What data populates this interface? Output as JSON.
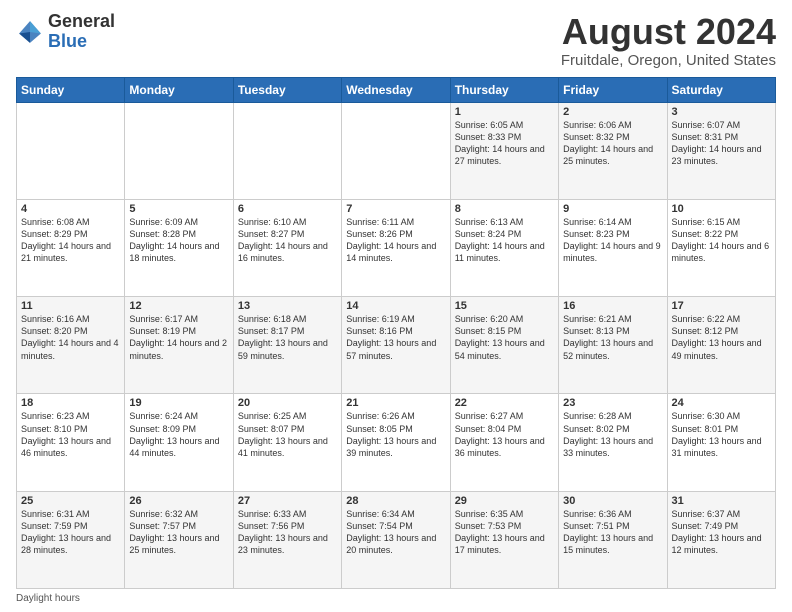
{
  "logo": {
    "general": "General",
    "blue": "Blue"
  },
  "title": {
    "month_year": "August 2024",
    "location": "Fruitdale, Oregon, United States"
  },
  "days_of_week": [
    "Sunday",
    "Monday",
    "Tuesday",
    "Wednesday",
    "Thursday",
    "Friday",
    "Saturday"
  ],
  "weeks": [
    [
      {
        "day": "",
        "info": ""
      },
      {
        "day": "",
        "info": ""
      },
      {
        "day": "",
        "info": ""
      },
      {
        "day": "",
        "info": ""
      },
      {
        "day": "1",
        "info": "Sunrise: 6:05 AM\nSunset: 8:33 PM\nDaylight: 14 hours and 27 minutes."
      },
      {
        "day": "2",
        "info": "Sunrise: 6:06 AM\nSunset: 8:32 PM\nDaylight: 14 hours and 25 minutes."
      },
      {
        "day": "3",
        "info": "Sunrise: 6:07 AM\nSunset: 8:31 PM\nDaylight: 14 hours and 23 minutes."
      }
    ],
    [
      {
        "day": "4",
        "info": "Sunrise: 6:08 AM\nSunset: 8:29 PM\nDaylight: 14 hours and 21 minutes."
      },
      {
        "day": "5",
        "info": "Sunrise: 6:09 AM\nSunset: 8:28 PM\nDaylight: 14 hours and 18 minutes."
      },
      {
        "day": "6",
        "info": "Sunrise: 6:10 AM\nSunset: 8:27 PM\nDaylight: 14 hours and 16 minutes."
      },
      {
        "day": "7",
        "info": "Sunrise: 6:11 AM\nSunset: 8:26 PM\nDaylight: 14 hours and 14 minutes."
      },
      {
        "day": "8",
        "info": "Sunrise: 6:13 AM\nSunset: 8:24 PM\nDaylight: 14 hours and 11 minutes."
      },
      {
        "day": "9",
        "info": "Sunrise: 6:14 AM\nSunset: 8:23 PM\nDaylight: 14 hours and 9 minutes."
      },
      {
        "day": "10",
        "info": "Sunrise: 6:15 AM\nSunset: 8:22 PM\nDaylight: 14 hours and 6 minutes."
      }
    ],
    [
      {
        "day": "11",
        "info": "Sunrise: 6:16 AM\nSunset: 8:20 PM\nDaylight: 14 hours and 4 minutes."
      },
      {
        "day": "12",
        "info": "Sunrise: 6:17 AM\nSunset: 8:19 PM\nDaylight: 14 hours and 2 minutes."
      },
      {
        "day": "13",
        "info": "Sunrise: 6:18 AM\nSunset: 8:17 PM\nDaylight: 13 hours and 59 minutes."
      },
      {
        "day": "14",
        "info": "Sunrise: 6:19 AM\nSunset: 8:16 PM\nDaylight: 13 hours and 57 minutes."
      },
      {
        "day": "15",
        "info": "Sunrise: 6:20 AM\nSunset: 8:15 PM\nDaylight: 13 hours and 54 minutes."
      },
      {
        "day": "16",
        "info": "Sunrise: 6:21 AM\nSunset: 8:13 PM\nDaylight: 13 hours and 52 minutes."
      },
      {
        "day": "17",
        "info": "Sunrise: 6:22 AM\nSunset: 8:12 PM\nDaylight: 13 hours and 49 minutes."
      }
    ],
    [
      {
        "day": "18",
        "info": "Sunrise: 6:23 AM\nSunset: 8:10 PM\nDaylight: 13 hours and 46 minutes."
      },
      {
        "day": "19",
        "info": "Sunrise: 6:24 AM\nSunset: 8:09 PM\nDaylight: 13 hours and 44 minutes."
      },
      {
        "day": "20",
        "info": "Sunrise: 6:25 AM\nSunset: 8:07 PM\nDaylight: 13 hours and 41 minutes."
      },
      {
        "day": "21",
        "info": "Sunrise: 6:26 AM\nSunset: 8:05 PM\nDaylight: 13 hours and 39 minutes."
      },
      {
        "day": "22",
        "info": "Sunrise: 6:27 AM\nSunset: 8:04 PM\nDaylight: 13 hours and 36 minutes."
      },
      {
        "day": "23",
        "info": "Sunrise: 6:28 AM\nSunset: 8:02 PM\nDaylight: 13 hours and 33 minutes."
      },
      {
        "day": "24",
        "info": "Sunrise: 6:30 AM\nSunset: 8:01 PM\nDaylight: 13 hours and 31 minutes."
      }
    ],
    [
      {
        "day": "25",
        "info": "Sunrise: 6:31 AM\nSunset: 7:59 PM\nDaylight: 13 hours and 28 minutes."
      },
      {
        "day": "26",
        "info": "Sunrise: 6:32 AM\nSunset: 7:57 PM\nDaylight: 13 hours and 25 minutes."
      },
      {
        "day": "27",
        "info": "Sunrise: 6:33 AM\nSunset: 7:56 PM\nDaylight: 13 hours and 23 minutes."
      },
      {
        "day": "28",
        "info": "Sunrise: 6:34 AM\nSunset: 7:54 PM\nDaylight: 13 hours and 20 minutes."
      },
      {
        "day": "29",
        "info": "Sunrise: 6:35 AM\nSunset: 7:53 PM\nDaylight: 13 hours and 17 minutes."
      },
      {
        "day": "30",
        "info": "Sunrise: 6:36 AM\nSunset: 7:51 PM\nDaylight: 13 hours and 15 minutes."
      },
      {
        "day": "31",
        "info": "Sunrise: 6:37 AM\nSunset: 7:49 PM\nDaylight: 13 hours and 12 minutes."
      }
    ]
  ],
  "footer": {
    "daylight_label": "Daylight hours"
  }
}
